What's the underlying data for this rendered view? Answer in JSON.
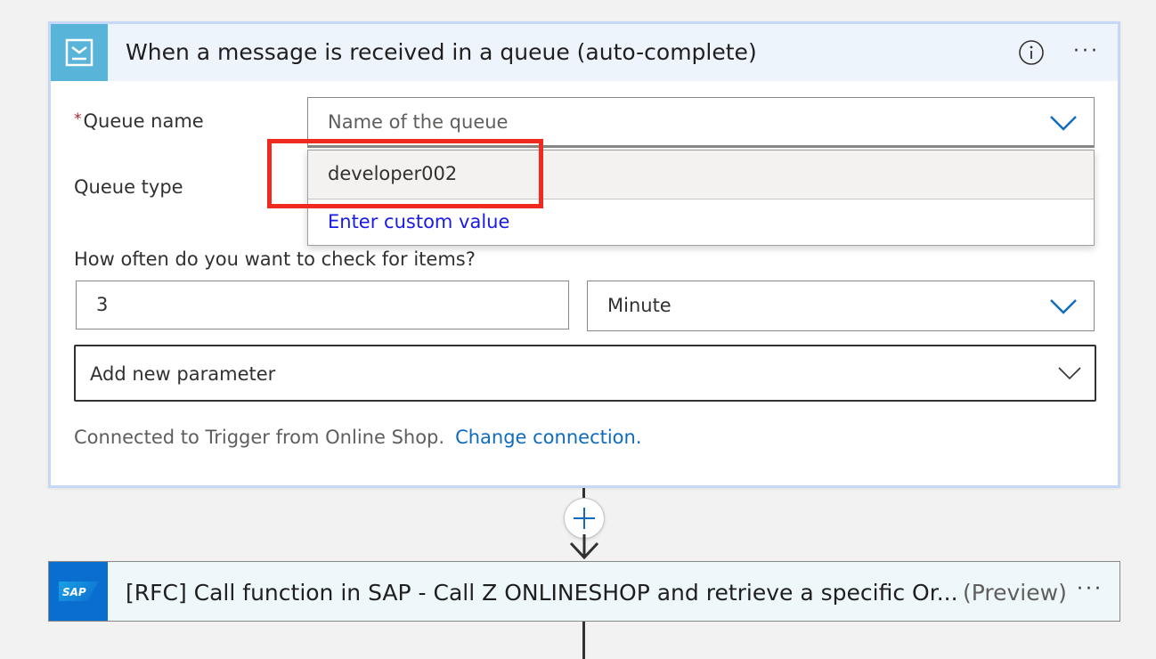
{
  "trigger": {
    "title": "When a message is received in a queue (auto-complete)",
    "more_label": "···",
    "queue_name": {
      "label": "Queue name",
      "required_marker": "*",
      "placeholder": "Name of the queue",
      "options": [
        "developer002"
      ],
      "custom_value_label": "Enter custom value"
    },
    "queue_type": {
      "label": "Queue type"
    },
    "interval": {
      "label": "How often do you want to check for items?",
      "value": "3",
      "frequency": "Minute"
    },
    "add_parameter_label": "Add new parameter",
    "connection": {
      "text": "Connected to Trigger from Online Shop.",
      "change_label": "Change connection."
    }
  },
  "sap_action": {
    "title": "[RFC] Call function in SAP - Call Z ONLINESHOP and retrieve a specific Or...",
    "preview_label": "(Preview)",
    "more_label": "···",
    "logo_text": "SAP"
  },
  "colors": {
    "trigger_icon_bg": "#59b4d9",
    "header_bg": "#edf4fc",
    "link": "#0f6cbd",
    "highlight": "#ef2a1f",
    "sap_blue": "#0a6ed1"
  }
}
